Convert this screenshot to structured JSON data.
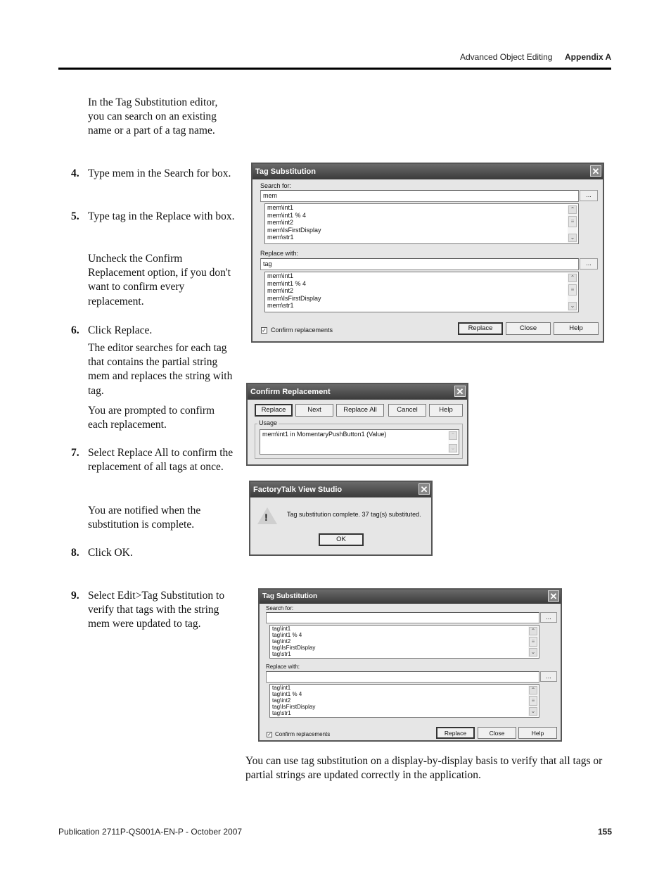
{
  "header": {
    "section": "Advanced Object Editing",
    "appendix": "Appendix A"
  },
  "footer": {
    "publication": "Publication 2711P-QS001A-EN-P - October 2007",
    "page_number": "155"
  },
  "intro": "In the Tag Substitution editor, you can search on an existing name or a part of a tag name.",
  "steps": [
    {
      "num": "4.",
      "text": "Type mem in the Search for box."
    },
    {
      "num": "5.",
      "text": "Type tag in the Replace with box."
    },
    {
      "num": "6.",
      "text": "Click Replace."
    },
    {
      "num": "7.",
      "text": "Select Replace All to confirm the replacement of all tags at once."
    },
    {
      "num": "8.",
      "text": "Click OK."
    },
    {
      "num": "9.",
      "text": "Select Edit>Tag Substitution to verify that tags with the string mem were updated to tag."
    }
  ],
  "notes": {
    "uncheck": "Uncheck the Confirm Replacement option, if you don't want to confirm every replacement.",
    "editor_searches": "The editor searches for each tag that contains the partial string mem and replaces the string with tag.",
    "prompted": "You are prompted to confirm each replacement.",
    "notified": "You are notified when the substitution is complete."
  },
  "closing": "You can use tag substitution on a display-by-display basis to verify that all tags or partial strings are updated correctly in the application.",
  "dialog1": {
    "title": "Tag Substitution",
    "search_label": "Search for:",
    "search_value": "mem",
    "search_items": [
      "mem\\int1",
      "mem\\int1 % 4",
      "mem\\int2",
      "mem\\IsFirstDisplay",
      "mem\\str1"
    ],
    "replace_label": "Replace with:",
    "replace_value": "tag",
    "replace_items": [
      "mem\\int1",
      "mem\\int1 % 4",
      "mem\\int2",
      "mem\\IsFirstDisplay",
      "mem\\str1"
    ],
    "browse": "...",
    "confirm_label": "Confirm replacements",
    "confirm_checked": true,
    "buttons": {
      "replace": "Replace",
      "close": "Close",
      "help": "Help"
    }
  },
  "dialog2": {
    "title": "Confirm Replacement",
    "buttons": {
      "replace": "Replace",
      "next": "Next",
      "replace_all": "Replace All",
      "cancel": "Cancel",
      "help": "Help"
    },
    "usage_label": "Usage",
    "usage_text": "mem\\int1 in MomentaryPushButton1 (Value)"
  },
  "dialog3": {
    "title": "FactoryTalk View Studio",
    "message": "Tag substitution complete. 37 tag(s) substituted.",
    "ok": "OK"
  },
  "dialog4": {
    "title": "Tag Substitution",
    "search_label": "Search for:",
    "search_value": "",
    "search_items": [
      "tag\\int1",
      "tag\\int1 % 4",
      "tag\\int2",
      "tag\\IsFirstDisplay",
      "tag\\str1"
    ],
    "replace_label": "Replace with:",
    "replace_value": "",
    "replace_items": [
      "tag\\int1",
      "tag\\int1 % 4",
      "tag\\int2",
      "tag\\IsFirstDisplay",
      "tag\\str1"
    ],
    "browse": "...",
    "confirm_label": "Confirm replacements",
    "confirm_checked": true,
    "buttons": {
      "replace": "Replace",
      "close": "Close",
      "help": "Help"
    }
  },
  "icons": {
    "close": "✕",
    "scroll_up": "⌃",
    "scroll_down": "⌄",
    "thumb": "≡",
    "check": "✓",
    "warning": "!"
  }
}
